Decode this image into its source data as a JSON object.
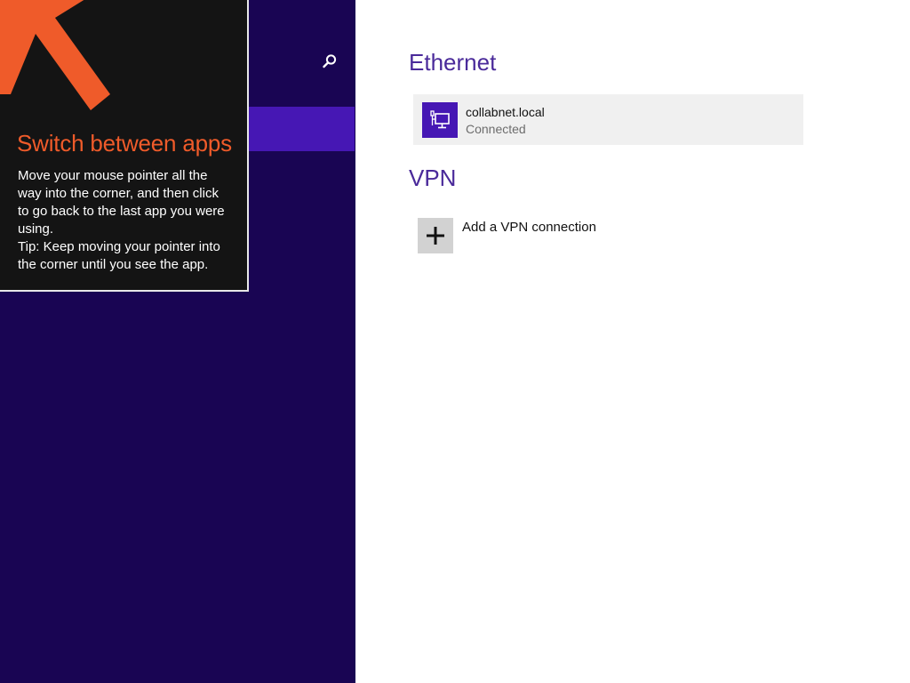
{
  "nav": {
    "search_icon": "search-icon",
    "accent_color": "#4617b4",
    "background_color": "#190553"
  },
  "tip": {
    "title": "Switch between apps",
    "body_lines": [
      "Move your mouse pointer all the",
      "way into the corner, and then click",
      "to go back to the last app you were",
      "using.",
      "Tip: Keep moving your pointer into",
      "the corner until you see the app."
    ],
    "arrow_icon": "arrow-up-left-icon",
    "title_color": "#ef5b2a"
  },
  "ethernet": {
    "heading": "Ethernet",
    "network": {
      "name": "collabnet.local",
      "status": "Connected",
      "icon": "wired-network-icon"
    }
  },
  "vpn": {
    "heading": "VPN",
    "add_label": "Add a VPN connection",
    "add_icon": "plus-icon"
  }
}
